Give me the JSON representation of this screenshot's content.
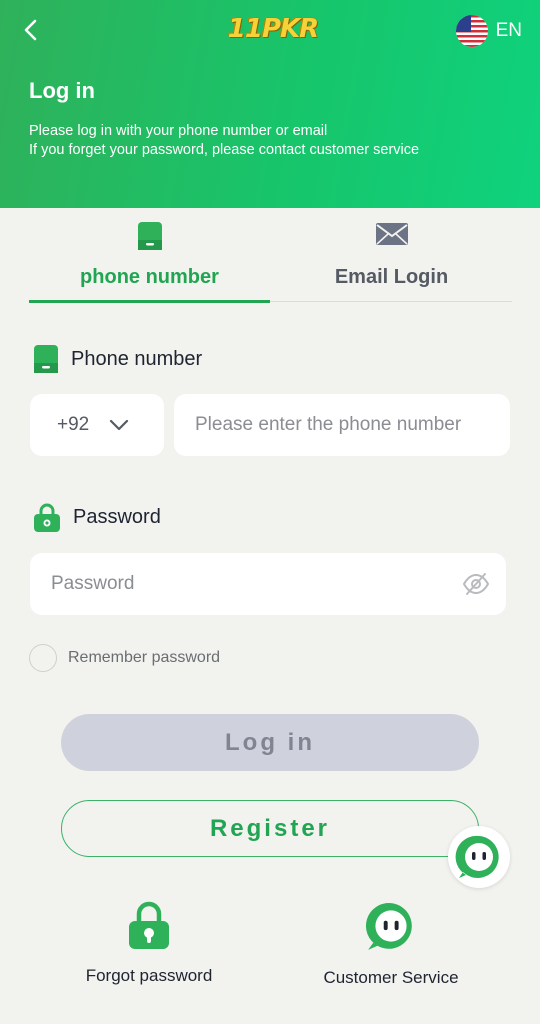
{
  "header": {
    "logo_text": "11PKR",
    "language": "EN",
    "title": "Log in",
    "subtitle_line1": "Please log in with your phone number or email",
    "subtitle_line2": "If you forget your password, please contact customer service"
  },
  "tabs": [
    {
      "label": "phone number",
      "active": true
    },
    {
      "label": "Email Login",
      "active": false
    }
  ],
  "phone_section": {
    "label": "Phone number",
    "country_code": "+92",
    "placeholder": "Please enter the phone number",
    "value": ""
  },
  "password_section": {
    "label": "Password",
    "placeholder": "Password",
    "value": ""
  },
  "remember": {
    "label": "Remember password",
    "checked": false
  },
  "buttons": {
    "login": "Log in",
    "register": "Register"
  },
  "bottom_links": {
    "forgot": "Forgot password",
    "service": "Customer Service"
  },
  "icons": {
    "back": "chevron-left-icon",
    "flag": "us-flag-icon",
    "phone": "phone-icon",
    "email": "envelope-icon",
    "lock": "lock-icon",
    "eye": "eye-off-icon",
    "chevron": "chevron-down-icon",
    "chat": "chat-bubble-icon"
  },
  "colors": {
    "accent": "#22a553",
    "header_start": "#2fb15a",
    "header_end": "#0fd27d",
    "login_disabled_bg": "#cfd2dd",
    "background": "#f2f2ef"
  }
}
